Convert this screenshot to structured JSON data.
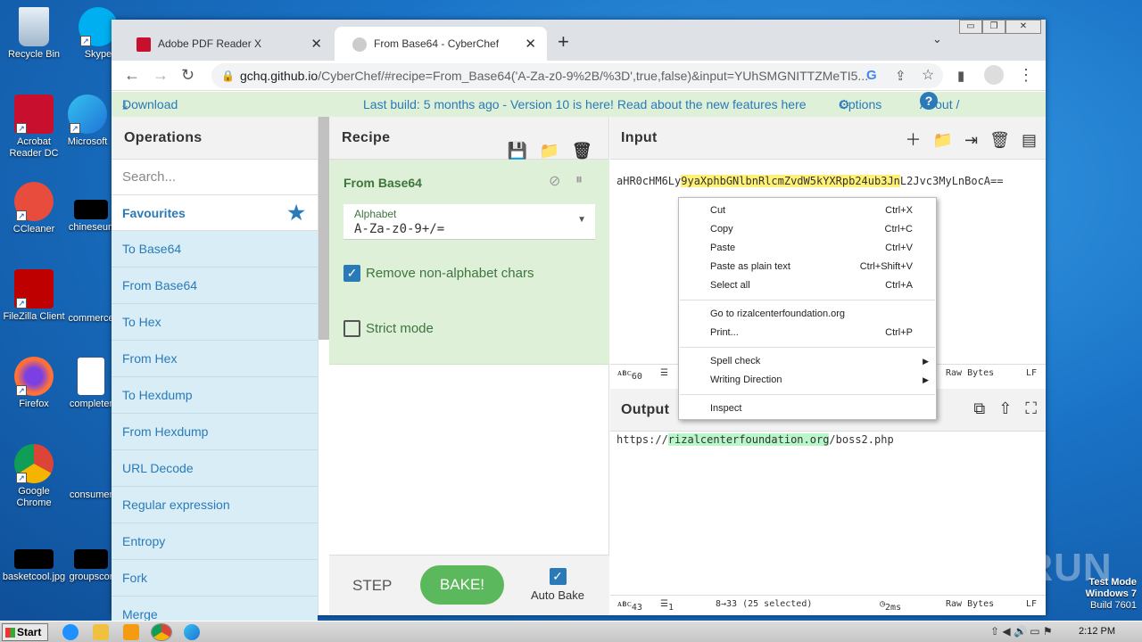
{
  "desktop": {
    "icons": [
      {
        "label": "Recycle Bin"
      },
      {
        "label": "Skype"
      },
      {
        "label": "Acrobat Reader DC"
      },
      {
        "label": "Microsoft"
      },
      {
        "label": "CCleaner"
      },
      {
        "label": "chineseun"
      },
      {
        "label": "FileZilla Client"
      },
      {
        "label": "commerce"
      },
      {
        "label": "Firefox"
      },
      {
        "label": "completer"
      },
      {
        "label": "Google Chrome"
      },
      {
        "label": "consumer"
      },
      {
        "label": "basketcool.jpg"
      },
      {
        "label": "groupscor"
      }
    ],
    "watermark": "ANY RUN",
    "test_mode": [
      "Test Mode",
      "Windows 7",
      "Build 7601"
    ]
  },
  "browser": {
    "tabs": [
      {
        "title": "Adobe PDF Reader X",
        "close": "✕"
      },
      {
        "title": "From Base64 - CyberChef",
        "close": "✕"
      }
    ],
    "new_tab": "+",
    "url_domain": "gchq.github.io",
    "url_rest": "/CyberChef/#recipe=From_Base64('A-Za-z0-9%2B/%3D',true,false)&input=YUhSMGNITTZMeTI5...",
    "window_controls": [
      "▭",
      "❐",
      "✕"
    ]
  },
  "banner": {
    "download": "Download CyberChef",
    "last_build": "Last build: 5 months ago - Version 10 is here! Read about the new features here",
    "options": "Options",
    "about": "About / Support"
  },
  "operations": {
    "title": "Operations",
    "search_placeholder": "Search...",
    "favourites": "Favourites",
    "items": [
      "To Base64",
      "From Base64",
      "To Hex",
      "From Hex",
      "To Hexdump",
      "From Hexdump",
      "URL Decode",
      "Regular expression",
      "Entropy",
      "Fork",
      "Merge"
    ]
  },
  "recipe": {
    "title": "Recipe",
    "operation": "From Base64",
    "alphabet_label": "Alphabet",
    "alphabet_value": "A-Za-z0-9+/=",
    "remove_non_alpha": "Remove non-alphabet chars",
    "strict_mode": "Strict mode",
    "step": "STEP",
    "bake": "BAKE!",
    "auto_bake": "Auto Bake"
  },
  "input": {
    "title": "Input",
    "text_before": "aHR0cHM6Ly",
    "text_highlight": "9yaXphbGNlbnRlcmZvdW5kYXRpb24ub3Jn",
    "text_after": "L2Jvc3MyLnBocA==",
    "status_chars": "60",
    "status_lines": "1",
    "status_format": "Raw Bytes",
    "status_eol": "LF"
  },
  "output": {
    "title": "Output",
    "text_before": "https://",
    "text_highlight": "rizalcenterfoundation.org",
    "text_after": "/boss2.php",
    "status_chars": "43",
    "status_lines": "1",
    "status_selection": "8→33 (25 selected)",
    "status_time": "2ms",
    "status_format": "Raw Bytes",
    "status_eol": "LF"
  },
  "context_menu": {
    "items": [
      {
        "label": "Cut",
        "shortcut": "Ctrl+X"
      },
      {
        "label": "Copy",
        "shortcut": "Ctrl+C"
      },
      {
        "label": "Paste",
        "shortcut": "Ctrl+V"
      },
      {
        "label": "Paste as plain text",
        "shortcut": "Ctrl+Shift+V"
      },
      {
        "label": "Select all",
        "shortcut": "Ctrl+A"
      },
      {
        "label": "Go to rizalcenterfoundation.org",
        "shortcut": ""
      },
      {
        "label": "Print...",
        "shortcut": "Ctrl+P"
      },
      {
        "label": "Spell check",
        "shortcut": ""
      },
      {
        "label": "Writing Direction",
        "shortcut": ""
      },
      {
        "label": "Inspect",
        "shortcut": ""
      }
    ]
  },
  "taskbar": {
    "start": "Start",
    "time": "2:12 PM"
  },
  "colors": {
    "accent": "#2a7ab8",
    "bake_green": "#5cb85c",
    "recipe_bg": "#dff0d8",
    "ops_bg": "#d9edf7",
    "highlight_yellow": "#fff176",
    "highlight_green": "#b9f6ca"
  }
}
